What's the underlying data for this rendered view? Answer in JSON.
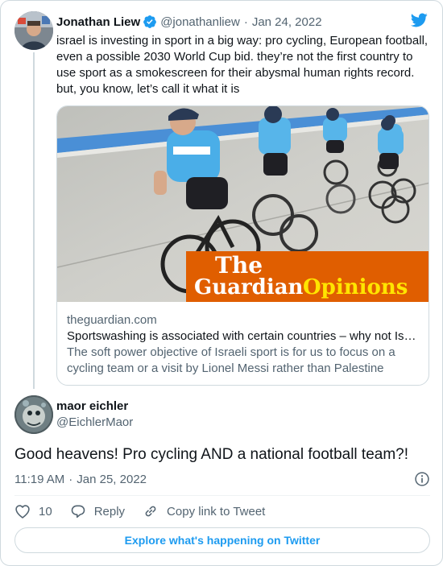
{
  "parent_tweet": {
    "author_name": "Jonathan Liew",
    "handle": "@jonathanliew",
    "date": "Jan 24, 2022",
    "text": "israel is investing in sport in a big way: pro cycling, European football, even a possible 2030 World Cup bid. they’re not the first country to use sport as a smokescreen for their abysmal human rights record. but, you know, let’s call it what it is",
    "link_card": {
      "image_brand_the": "The",
      "image_brand_guardian": "Guardian",
      "image_brand_section": "Opinions",
      "domain": "theguardian.com",
      "title": "Sportswashing is associated with certain countries – why not Israel?",
      "description": "The soft power objective of Israeli sport is for us to focus on a cycling team or a visit by Lionel Messi rather than Palestine"
    }
  },
  "reply_tweet": {
    "author_name": "maor eichler",
    "handle": "@EichlerMaor",
    "text": "Good heavens! Pro cycling AND a national football team?!",
    "time": "11:19 AM",
    "date": "Jan 25, 2022"
  },
  "actions": {
    "like_count": "10",
    "reply_label": "Reply",
    "copy_link_label": "Copy link to Tweet"
  },
  "footer": {
    "explore_label": "Explore what's happening on Twitter"
  },
  "icons": {
    "verified": "verified-badge-icon",
    "brand": "twitter-bird-icon",
    "info": "info-icon",
    "like": "heart-icon",
    "reply": "speech-bubble-icon",
    "copy_link": "link-icon"
  },
  "colors": {
    "accent": "#1d9bf0",
    "guardian_orange": "#e05e00",
    "muted_text": "#536471",
    "border": "#cfd9de"
  }
}
